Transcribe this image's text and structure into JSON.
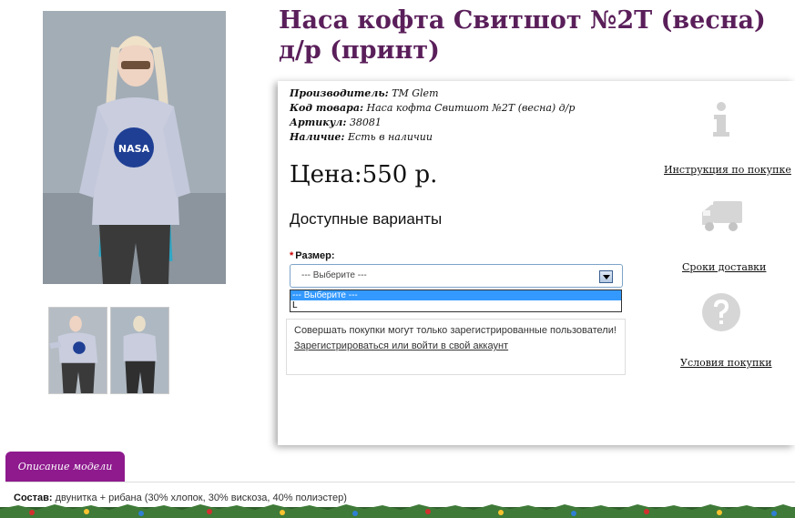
{
  "product": {
    "title": "Наса кофта Свитшот №2Т (весна) д/р (принт)",
    "manufacturer_label": "Производитель:",
    "manufacturer": "TM Glem",
    "code_label": "Код товара:",
    "code": "Наса кофта Свитшот №2Т (весна) д/р",
    "article_label": "Артикул:",
    "article": "38081",
    "availability_label": "Наличие:",
    "availability": "Есть в наличии",
    "price": "Цена:550 р."
  },
  "options": {
    "title": "Доступные варианты",
    "size_label": "Размер:",
    "select_value": "--- Выберите ---",
    "dropdown": [
      "--- Выберите ---",
      "L"
    ]
  },
  "notice": {
    "text": "Совершать покупки могут только зарегистрированные пользователи!",
    "link": "Зарегистрироваться или войти в свой аккаунт"
  },
  "side": {
    "instruction_link": "Инструкция по покупке",
    "delivery_link": "Сроки доставки",
    "terms_link": "Условия покупки"
  },
  "tabs": {
    "description": "Описание модели"
  },
  "composition": {
    "label": "Состав:",
    "value": "двунитка + рибана (30% хлопок, 30% вискоза, 40% полиэстер)"
  },
  "icons": {
    "info": "info-icon",
    "truck": "truck-icon",
    "question": "question-icon"
  },
  "colors": {
    "title": "#5a1f5a",
    "tab": "#8e1a8e",
    "select_highlight": "#3399ff"
  }
}
